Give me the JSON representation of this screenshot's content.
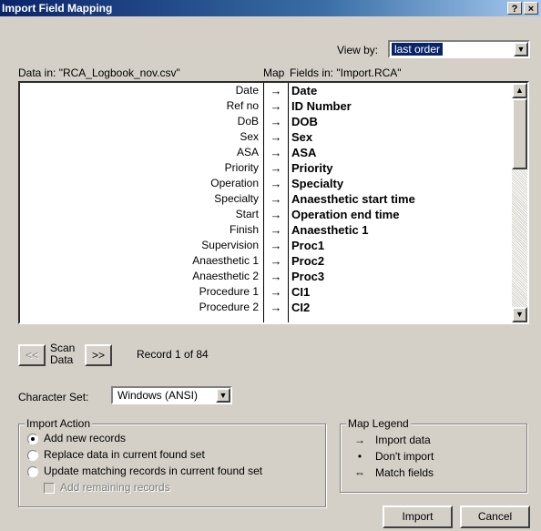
{
  "window": {
    "title": "Import Field Mapping",
    "help": "?",
    "close": "×"
  },
  "view_by": {
    "label": "View by:",
    "value": "last order"
  },
  "headers": {
    "source": "Data in: \"RCA_Logbook_nov.csv\"",
    "map": "Map",
    "target": "Fields in: \"Import.RCA\""
  },
  "mapping": {
    "source": [
      "Date",
      "Ref no",
      "DoB",
      "Sex",
      "ASA",
      "Priority",
      "Operation",
      "Specialty",
      "Start",
      "Finish",
      "Supervision",
      "Anaesthetic 1",
      "Anaesthetic 2",
      "Procedure 1",
      "Procedure 2"
    ],
    "arrows": [
      "→",
      "→",
      "→",
      "→",
      "→",
      "→",
      "→",
      "→",
      "→",
      "→",
      "→",
      "→",
      "→",
      "→",
      "→"
    ],
    "target": [
      "Date",
      "ID Number",
      "DOB",
      "Sex",
      "ASA",
      "Priority",
      "Specialty",
      "Anaesthetic start time",
      "Operation end time",
      "Anaesthetic 1",
      "Proc1",
      "Proc2",
      "Proc3",
      "CI1",
      "CI2"
    ]
  },
  "scan": {
    "prev": "<<",
    "label_top": "Scan",
    "label_bottom": "Data",
    "next": ">>",
    "record_text": "Record 1 of 84"
  },
  "charset": {
    "label": "Character Set:",
    "value": "Windows (ANSI)"
  },
  "import_action": {
    "title": "Import Action",
    "options": [
      "Add new records",
      "Replace data in current found set",
      "Update matching records in current found set"
    ],
    "selected_index": 0,
    "add_remaining": "Add remaining records"
  },
  "legend": {
    "title": "Map Legend",
    "items": [
      {
        "symbol": "→",
        "label": "Import data"
      },
      {
        "symbol": "•",
        "label": "Don't import"
      },
      {
        "symbol": "⇔",
        "label": "Match fields"
      }
    ]
  },
  "buttons": {
    "import": "Import",
    "cancel": "Cancel"
  }
}
